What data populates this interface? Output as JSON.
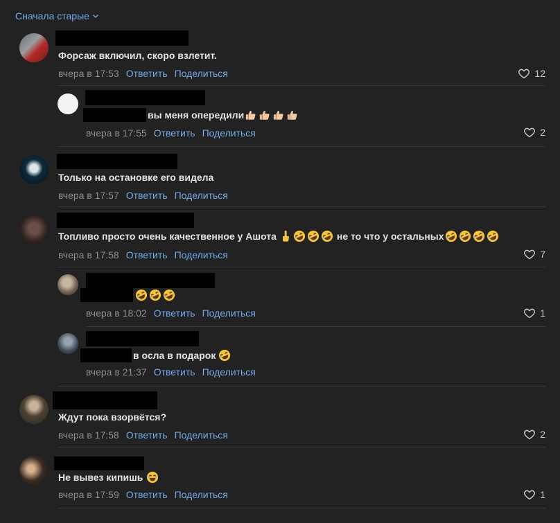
{
  "sort_label": "Сначала старые",
  "reply_label": "Ответить",
  "share_label": "Поделиться",
  "comments": [
    {
      "text": "Форсаж включил, скоро взлетит.",
      "time": "вчера в 17:53",
      "likes": "12"
    },
    {
      "text": "вы меня опередили",
      "time": "вчера в 17:55",
      "likes": "2"
    },
    {
      "text": "Только на остановке его видела",
      "time": "вчера в 17:57",
      "likes": ""
    },
    {
      "text": "Топливо просто очень качественное у Ашота",
      "text2": "не то что у остальных",
      "time": "вчера в 17:58",
      "likes": "7"
    },
    {
      "text": "",
      "time": "вчера в 18:02",
      "likes": "1"
    },
    {
      "text": "в осла в подарок",
      "time": "вчера в 21:37",
      "likes": ""
    },
    {
      "text": "Ждут пока взорвётся?",
      "time": "вчера в 17:58",
      "likes": "2"
    },
    {
      "text": "Не вывез кипишь",
      "time": "вчера в 17:59",
      "likes": "1"
    }
  ],
  "colors": {
    "background": "#222222",
    "link": "#71aaeb",
    "meta": "#8c8e91",
    "text": "#e1e3e6"
  }
}
